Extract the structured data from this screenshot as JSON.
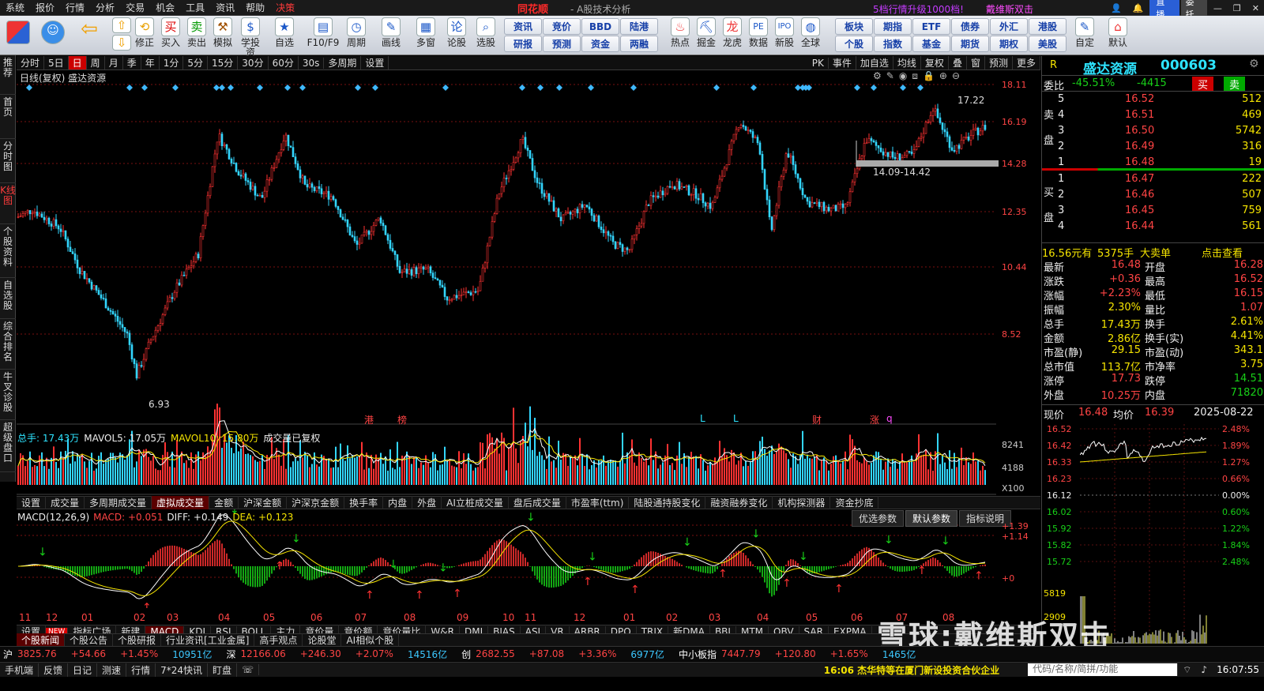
{
  "menu": [
    "系统",
    "报价",
    "行情",
    "分析",
    "交易",
    "机会",
    "工具",
    "资讯",
    "帮助",
    "决策"
  ],
  "brand": "同花顺",
  "brand_sub": "- A股技术分析",
  "promo1": "5档行情升级1000档!",
  "promo2": "戴维斯双击",
  "win": {
    "live": "直播",
    "entrust": "委托"
  },
  "toolbar": [
    "修正",
    "买入",
    "卖出",
    "模拟",
    "学投资",
    "自选",
    "F10/F9",
    "周期",
    "画线",
    "多窗",
    "论股",
    "选股"
  ],
  "toolbar2_top": [
    "资讯",
    "竞价",
    "BBD",
    "陆港"
  ],
  "toolbar2_bot": [
    "研报",
    "预测",
    "资金",
    "两融"
  ],
  "toolbar3": [
    "热点",
    "掘金",
    "龙虎",
    "数据",
    "新股",
    "全球"
  ],
  "toolbar4_top": [
    "板块",
    "期指",
    "ETF",
    "债券",
    "外汇",
    "港股"
  ],
  "toolbar4_bot": [
    "个股",
    "指数",
    "基金",
    "期货",
    "期权",
    "美股"
  ],
  "toolbar5": [
    "自定",
    "默认"
  ],
  "vtabs": [
    "推荐",
    "首页",
    "分时图",
    "K线图",
    "个股资料",
    "自选股",
    "综合排名",
    "牛叉诊股",
    "超级盘口"
  ],
  "periods": [
    "分时",
    "5日",
    "日",
    "周",
    "月",
    "季",
    "年",
    "1分",
    "5分",
    "15分",
    "30分",
    "60分",
    "30s",
    "多周期",
    "设置"
  ],
  "period_right": [
    "PK",
    "事件",
    "加自选",
    "均线",
    "复权",
    "叠",
    "窗",
    "预测",
    "更多"
  ],
  "chart_title": "日线(复权)  盛达资源",
  "price_axis": [
    "18.11",
    "16.19",
    "14.28",
    "12.35",
    "10.44",
    "8.52"
  ],
  "annot_low": "6.93",
  "annot_high": "17.22",
  "annot_band": "14.09-14.42",
  "event_marks": [
    "港",
    "榜",
    "L",
    "L",
    "财",
    "涨",
    "q"
  ],
  "vol_legend": {
    "total": "总手: 17.43万",
    "mavol5": "MAVOL5: 17.05万",
    "mavol10": "MAVOL10: 15.80万",
    "note": "成交量已复权"
  },
  "vol_axis": [
    "8241",
    "4188",
    "X100"
  ],
  "ind_tabs": [
    "设置",
    "成交量",
    "多周期成交量",
    "虚拟成交量",
    "金额",
    "沪深金额",
    "沪深京金额",
    "换手率",
    "内盘",
    "外盘",
    "AI立桩成交量",
    "盘后成交量",
    "市盈率(ttm)",
    "陆股通持股变化",
    "融资融券变化",
    "机构探测器",
    "资金抄底"
  ],
  "macd_legend": {
    "name": "MACD(12,26,9)",
    "macd": "MACD: +0.051",
    "diff": "DIFF: +0.149",
    "dea": "DEA: +0.123"
  },
  "macd_btns": [
    "优选参数",
    "默认参数",
    "指标说明"
  ],
  "macd_axis": [
    "+1.39",
    "+1.14",
    "+0"
  ],
  "months": [
    "11",
    "12",
    "01",
    "02",
    "03",
    "04",
    "05",
    "06",
    "07",
    "08",
    "09",
    "10",
    "11",
    "12",
    "01",
    "02",
    "03",
    "04",
    "05",
    "06",
    "07",
    "08"
  ],
  "ind_list": [
    "设置",
    "NEW",
    "指标广场",
    "新建",
    "MACD",
    "KDJ",
    "RSI",
    "BOLL",
    "主力",
    "竞价量",
    "竞价额",
    "竞价量比",
    "W&R",
    "DMI",
    "BIAS",
    "ASI",
    "VR",
    "ARBR",
    "DPO",
    "TRIX",
    "新DMA",
    "BBI",
    "MTM",
    "OBV",
    "SAR",
    "EXPMA"
  ],
  "news_tabs": [
    "个股新闻",
    "个股公告",
    "个股研报",
    "行业资讯[工业金属]",
    "高手观点",
    "论股堂",
    "AI相似个股"
  ],
  "index_bar": [
    {
      "name": "沪",
      "val": "3825.76",
      "chg": "+54.66",
      "pct": "+1.45%",
      "amt": "10951亿"
    },
    {
      "name": "深",
      "val": "12166.06",
      "chg": "+246.30",
      "pct": "+2.07%",
      "amt": "14516亿"
    },
    {
      "name": "创",
      "val": "2682.55",
      "chg": "+87.08",
      "pct": "+3.36%",
      "amt": "6977亿"
    },
    {
      "name": "中小板指",
      "val": "7447.79",
      "chg": "+120.80",
      "pct": "+1.65%",
      "amt": "1465亿"
    }
  ],
  "bottom_bar": [
    "手机端",
    "反馈",
    "日记",
    "测速",
    "行情",
    "7*24快讯",
    "盯盘"
  ],
  "ticker_news": "16:06 杰华特等在厦门新设投资合伙企业",
  "search_hint": "代码/名称/简拼/功能",
  "clock": "16:07:55",
  "stock": {
    "flag": "R",
    "name": "盛达资源",
    "code": "000603"
  },
  "weibi": {
    "label": "委比",
    "pct": "-45.51%",
    "diff": "-4415",
    "buy": "买",
    "sell": "卖"
  },
  "sell_label": "卖盘",
  "buy_label": "买盘",
  "asks": [
    {
      "lv": "5",
      "price": "16.52",
      "vol": "512"
    },
    {
      "lv": "4",
      "price": "16.51",
      "vol": "469"
    },
    {
      "lv": "3",
      "price": "16.50",
      "vol": "5742"
    },
    {
      "lv": "2",
      "price": "16.49",
      "vol": "316"
    },
    {
      "lv": "1",
      "price": "16.48",
      "vol": "19"
    }
  ],
  "bids": [
    {
      "lv": "1",
      "price": "16.47",
      "vol": "222"
    },
    {
      "lv": "2",
      "price": "16.46",
      "vol": "507"
    },
    {
      "lv": "3",
      "price": "16.45",
      "vol": "759"
    },
    {
      "lv": "4",
      "price": "16.44",
      "vol": "561"
    }
  ],
  "bigorder": {
    "price": "16.56元有",
    "vol": "5375手",
    "label": "大卖单",
    "link": "点击查看"
  },
  "quote": [
    [
      "最新",
      "16.48",
      "开盘",
      "16.28"
    ],
    [
      "涨跌",
      "+0.36",
      "最高",
      "16.52"
    ],
    [
      "涨幅",
      "+2.23%",
      "最低",
      "16.15"
    ],
    [
      "振幅",
      "2.30%",
      "量比",
      "1.07"
    ],
    [
      "总手",
      "17.43万",
      "换手",
      "2.61%"
    ],
    [
      "金额",
      "2.86亿",
      "换手(实)",
      "4.41%"
    ],
    [
      "市盈(静)",
      "29.15",
      "市盈(动)",
      "343.1"
    ],
    [
      "总市值",
      "113.7亿",
      "市净率",
      "3.75"
    ],
    [
      "涨停",
      "17.73",
      "跌停",
      "14.51"
    ],
    [
      "外盘",
      "10.25万",
      "内盘",
      "71820"
    ]
  ],
  "mini": {
    "label": "现价",
    "price": "16.48",
    "avg_label": "均价",
    "avg": "16.39",
    "date": "2025-08-22",
    "left_axis": [
      "16.52",
      "16.42",
      "16.33",
      "16.23",
      "16.12",
      "16.02",
      "15.92",
      "15.82",
      "15.72"
    ],
    "right_axis": [
      "2.48%",
      "1.89%",
      "1.27%",
      "0.66%",
      "0.00%",
      "0.60%",
      "1.22%",
      "1.84%",
      "2.48%"
    ],
    "vol_axis": [
      "5819",
      "2909"
    ]
  },
  "watermark": "雪球:戴维斯双击"
}
